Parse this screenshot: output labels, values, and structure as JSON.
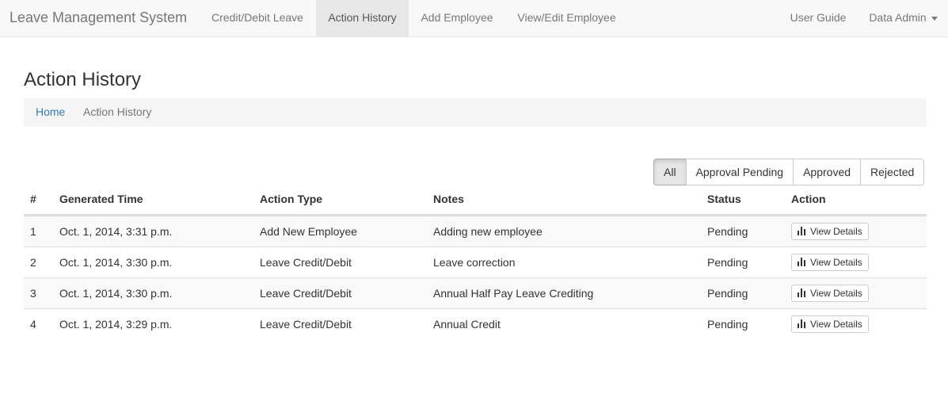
{
  "app": {
    "title": "Leave Management System"
  },
  "nav": {
    "items": [
      {
        "label": "Credit/Debit Leave"
      },
      {
        "label": "Action History"
      },
      {
        "label": "Add Employee"
      },
      {
        "label": "View/Edit Employee"
      }
    ],
    "user_guide": "User Guide",
    "user_menu": "Data Admin"
  },
  "page": {
    "title": "Action History"
  },
  "breadcrumb": {
    "home": "Home",
    "separator": "/",
    "current": "Action History"
  },
  "filters": {
    "selected": "All",
    "options": [
      "All",
      "Approval Pending",
      "Approved",
      "Rejected"
    ]
  },
  "table": {
    "headers": [
      "#",
      "Generated Time",
      "Action Type",
      "Notes",
      "Status",
      "Action"
    ],
    "rows": [
      {
        "num": "1",
        "time": "Oct. 1, 2014, 3:31 p.m.",
        "type": "Add New Employee",
        "notes": "Adding new employee",
        "status": "Pending",
        "action": "View Details"
      },
      {
        "num": "2",
        "time": "Oct. 1, 2014, 3:30 p.m.",
        "type": "Leave Credit/Debit",
        "notes": "Leave correction",
        "status": "Pending",
        "action": "View Details"
      },
      {
        "num": "3",
        "time": "Oct. 1, 2014, 3:30 p.m.",
        "type": "Leave Credit/Debit",
        "notes": "Annual Half Pay Leave Crediting",
        "status": "Pending",
        "action": "View Details"
      },
      {
        "num": "4",
        "time": "Oct. 1, 2014, 3:29 p.m.",
        "type": "Leave Credit/Debit",
        "notes": "Annual Credit",
        "status": "Pending",
        "action": "View Details"
      }
    ]
  },
  "icons": {
    "view_details": "bar-chart-icon",
    "user_menu": "caret-down-icon"
  },
  "colors": {
    "link": "#337ab7",
    "navbar_bg": "#f8f8f8",
    "active_tab_bg": "#e7e7e7"
  }
}
